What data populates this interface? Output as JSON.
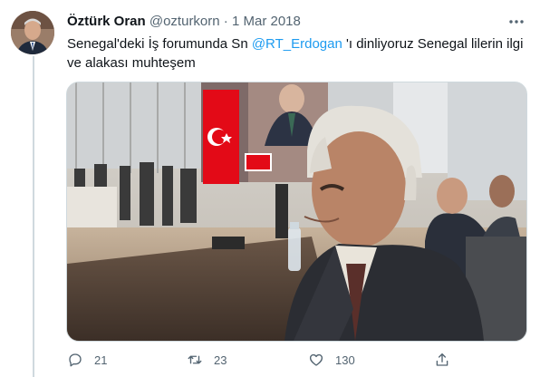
{
  "tweet": {
    "display_name": "Öztürk Oran",
    "handle": "@ozturkorn",
    "separator": "·",
    "date": "1 Mar 2018",
    "text_before": "Senegal'deki İş forumunda Sn ",
    "mention": "@RT_Erdogan",
    "text_after": " 'ı dinliyoruz Senegal lilerin ilgi ve alakası muhteşem"
  },
  "actions": {
    "reply_count": "21",
    "retweet_count": "23",
    "like_count": "130"
  },
  "icons": {
    "more": "more-icon",
    "reply": "reply-icon",
    "retweet": "retweet-icon",
    "like": "like-icon",
    "share": "share-icon"
  },
  "colors": {
    "link": "#1d9bf0",
    "secondary_text": "#536471",
    "turkish_flag": "#e30a17"
  }
}
